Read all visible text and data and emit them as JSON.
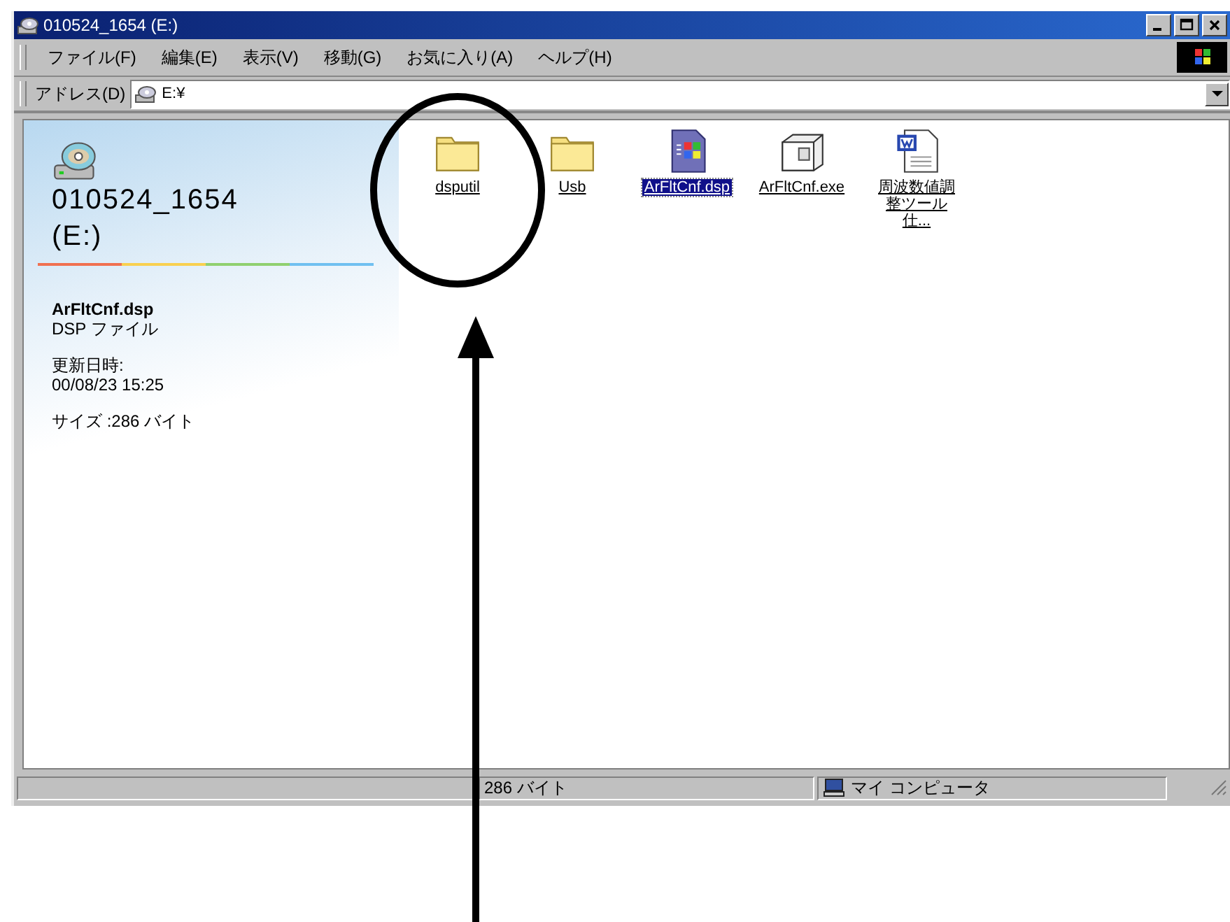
{
  "window": {
    "title": "010524_1654 (E:)"
  },
  "menu": [
    "ファイル(F)",
    "編集(E)",
    "表示(V)",
    "移動(G)",
    "お気に入り(A)",
    "ヘルプ(H)"
  ],
  "address": {
    "label": "アドレス(D)",
    "value": "E:¥"
  },
  "info_panel": {
    "drive_name": "010524_1654",
    "drive_letter": "(E:)",
    "file_name": "ArFltCnf.dsp",
    "file_type": "DSP ファイル",
    "modified_label": "更新日時:",
    "modified": "00/08/23 15:25",
    "size": "サイズ :286 バイト"
  },
  "files": [
    {
      "name": "dsputil",
      "kind": "folder",
      "selected": false
    },
    {
      "name": "Usb",
      "kind": "folder",
      "selected": false
    },
    {
      "name": "ArFltCnf.dsp",
      "kind": "dsp",
      "selected": true
    },
    {
      "name": "ArFltCnf.exe",
      "kind": "exe",
      "selected": false
    },
    {
      "name": "周波数値調整ツール仕...",
      "kind": "word",
      "selected": false
    }
  ],
  "status_bar": {
    "size": "286 バイト",
    "zone": "マイ コンピュータ"
  }
}
